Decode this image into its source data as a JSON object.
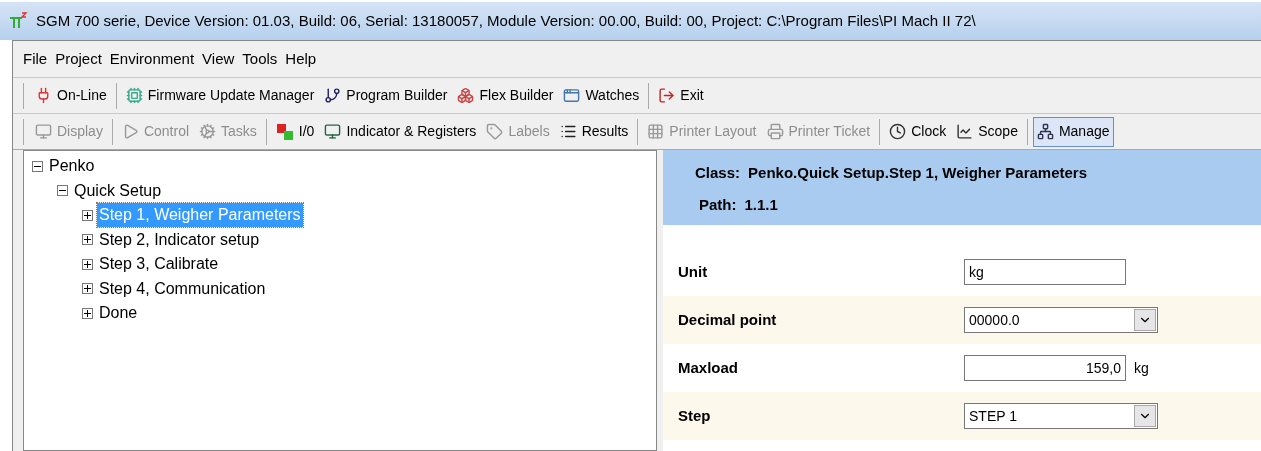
{
  "window": {
    "title": "SGM 700 serie, Device Version: 01.03, Build: 06, Serial: 13180057, Module Version: 00.00, Build: 00, Project: C:\\Program Files\\PI Mach II 72\\"
  },
  "menu": [
    "File",
    "Project",
    "Environment",
    "View",
    "Tools",
    "Help"
  ],
  "toolbar_1": [
    [
      {
        "label": "On-Line",
        "disabled": false,
        "selected": false
      }
    ],
    [
      {
        "label": "Firmware Update Manager",
        "disabled": false,
        "selected": false
      },
      {
        "label": "Program Builder",
        "disabled": false,
        "selected": false
      },
      {
        "label": "Flex Builder",
        "disabled": false,
        "selected": false
      },
      {
        "label": "Watches",
        "disabled": false,
        "selected": false
      }
    ],
    [
      {
        "label": "Exit",
        "disabled": false,
        "selected": false
      }
    ]
  ],
  "toolbar_2": [
    [
      {
        "label": "Display",
        "disabled": true,
        "selected": false
      }
    ],
    [
      {
        "label": "Control",
        "disabled": true,
        "selected": false
      },
      {
        "label": "Tasks",
        "disabled": true,
        "selected": false
      }
    ],
    [
      {
        "label": "I/0",
        "disabled": false,
        "selected": false
      },
      {
        "label": "Indicator & Registers",
        "disabled": false,
        "selected": false
      },
      {
        "label": "Labels",
        "disabled": true,
        "selected": false
      },
      {
        "label": "Results",
        "disabled": false,
        "selected": false
      }
    ],
    [
      {
        "label": "Printer Layout",
        "disabled": true,
        "selected": false
      },
      {
        "label": "Printer Ticket",
        "disabled": true,
        "selected": false
      }
    ],
    [
      {
        "label": "Clock",
        "disabled": false,
        "selected": false
      },
      {
        "label": "Scope",
        "disabled": false,
        "selected": false
      }
    ],
    [
      {
        "label": "Manage",
        "disabled": false,
        "selected": true
      }
    ]
  ],
  "tree": [
    {
      "label": "Penko",
      "expanded": true,
      "selected": false,
      "children": [
        {
          "label": "Quick Setup",
          "expanded": true,
          "selected": false,
          "children": [
            {
              "label": "Step 1, Weigher Parameters",
              "expanded": false,
              "selected": true
            },
            {
              "label": "Step 2, Indicator setup",
              "expanded": false,
              "selected": false
            },
            {
              "label": "Step 3, Calibrate",
              "expanded": false,
              "selected": false
            },
            {
              "label": "Step 4, Communication",
              "expanded": false,
              "selected": false
            },
            {
              "label": "Done",
              "expanded": false,
              "selected": false
            }
          ]
        }
      ]
    }
  ],
  "details": {
    "class_label": "Class:",
    "class_value": "Penko.Quick Setup.Step 1, Weigher Parameters",
    "path_label": "Path:",
    "path_value": "1.1.1"
  },
  "fields": [
    {
      "label": "Unit",
      "kind": "text",
      "value": "kg"
    },
    {
      "label": "Decimal point",
      "kind": "select",
      "value": "00000.0"
    },
    {
      "label": "Maxload",
      "kind": "number",
      "value": "159,0",
      "unit": "kg"
    },
    {
      "label": "Step",
      "kind": "select",
      "value": "STEP 1"
    }
  ]
}
